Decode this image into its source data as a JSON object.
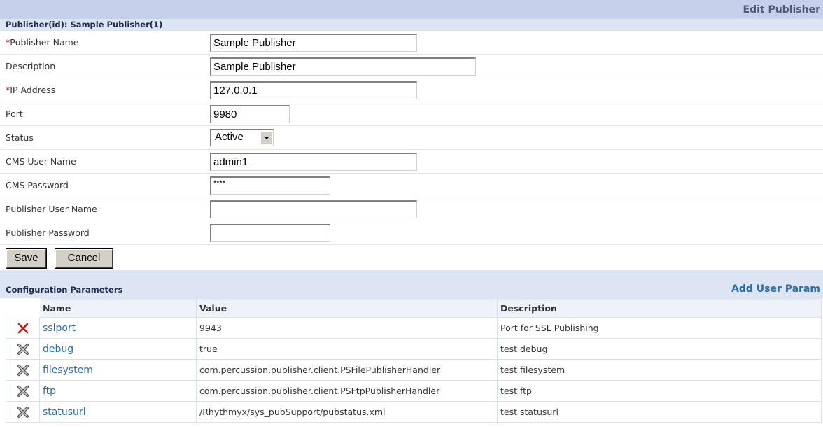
{
  "header": {
    "title": "Edit Publisher"
  },
  "publisher_id_label": "Publisher(id): Sample Publisher(1)",
  "form": {
    "publisher_name": {
      "label": "Publisher Name",
      "required_mark": "*",
      "value": "Sample Publisher"
    },
    "description": {
      "label": "Description",
      "value": "Sample Publisher"
    },
    "ip_address": {
      "label": "IP Address",
      "required_mark": "*",
      "value": "127.0.0.1"
    },
    "port": {
      "label": "Port",
      "value": "9980"
    },
    "status": {
      "label": "Status",
      "value": "Active"
    },
    "cms_user_name": {
      "label": "CMS User Name",
      "value": "admin1"
    },
    "cms_password": {
      "label": "CMS Password",
      "value": "****"
    },
    "publisher_user_name": {
      "label": "Publisher User Name",
      "value": ""
    },
    "publisher_password": {
      "label": "Publisher Password",
      "value": ""
    }
  },
  "buttons": {
    "save": "Save",
    "cancel": "Cancel"
  },
  "config": {
    "title": "Configuration Parameters",
    "add_link": "Add User Param",
    "columns": {
      "name": "Name",
      "value": "Value",
      "description": "Description"
    },
    "rows": [
      {
        "name": "sslport",
        "value": "9943",
        "description": "Port for SSL Publishing",
        "icon": "red-delete-icon"
      },
      {
        "name": "debug",
        "value": "true",
        "description": "test debug",
        "icon": "gray-delete-icon"
      },
      {
        "name": "filesystem",
        "value": "com.percussion.publisher.client.PSFilePublisherHandler",
        "description": "test filesystem",
        "icon": "gray-delete-icon"
      },
      {
        "name": "ftp",
        "value": "com.percussion.publisher.client.PSFtpPublisherHandler",
        "description": "test ftp",
        "icon": "gray-delete-icon"
      },
      {
        "name": "statusurl",
        "value": "/Rhythmyx/sys_pubSupport/pubstatus.xml",
        "description": "test statusurl",
        "icon": "gray-delete-icon"
      }
    ]
  },
  "colors": {
    "header_bg": "#c7d0ea",
    "section_bg": "#dde5f5",
    "link": "#2a6ea3",
    "required": "#cc0000"
  }
}
